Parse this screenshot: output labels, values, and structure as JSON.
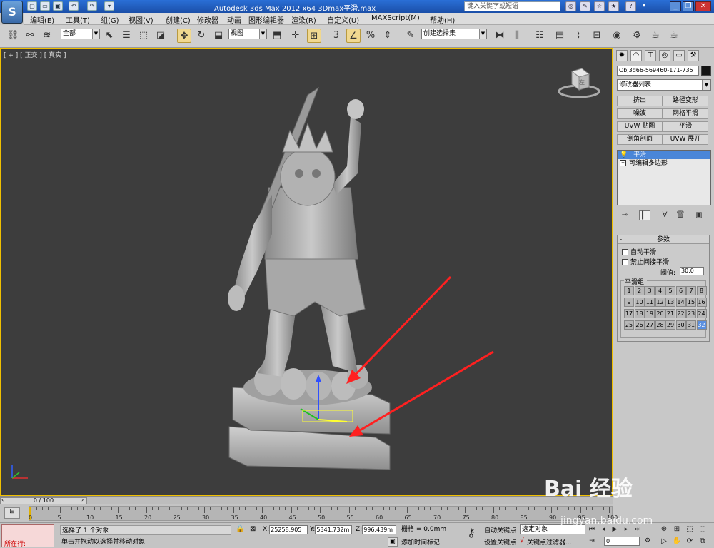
{
  "app": {
    "title": "Autodesk 3ds Max  2012 x64    3Dmax平滑.max",
    "logo_letter": "S",
    "search_placeholder": "键入关键字或短语"
  },
  "quick_access": [
    "new-icon",
    "open-icon",
    "save-icon",
    "undo-icon",
    "redo-icon",
    "dropdown-icon"
  ],
  "title_tools": [
    "binoculars-icon",
    "tools-icon",
    "star-icon",
    "favorite-icon",
    "help-icon"
  ],
  "menus": [
    "编辑(E)",
    "工具(T)",
    "组(G)",
    "视图(V)",
    "创建(C)",
    "修改器",
    "动画",
    "图形编辑器",
    "渲染(R)",
    "自定义(U)",
    "MAXScript(M)",
    "帮助(H)"
  ],
  "toolbar": {
    "selection_filter": "全部",
    "ref_coord": "视图",
    "named_selection": "创建选择集"
  },
  "viewport": {
    "label": "[ + ] [ 正交 ] [ 真实 ]",
    "viewcube_label": "左",
    "border_color": "#f0c000",
    "bg_color": "#3d3d3d"
  },
  "panel": {
    "tabs": [
      "create-icon",
      "modify-icon",
      "hierarchy-icon",
      "motion-icon",
      "display-icon",
      "utilities-icon"
    ],
    "object_name": "Obj3d66-569460-171-735",
    "object_color": "#141414",
    "modifier_list": "修改器列表",
    "modifier_buttons": [
      "挤出",
      "路径变形",
      "噪波",
      "网格平滑",
      "UVW 贴图",
      "平滑",
      "倒角剖面",
      "UVW 展开"
    ],
    "stack": [
      {
        "label": "平滑",
        "selected": true
      },
      {
        "label": "可编辑多边形",
        "selected": false
      }
    ],
    "stack_tools": [
      "pin-stack-icon",
      "show-end-result-icon",
      "make-unique-icon",
      "remove-modifier-icon",
      "configure-sets-icon"
    ],
    "rollout_title": "参数",
    "auto_smooth": "自动平滑",
    "prevent_indirect": "禁止间接平滑",
    "threshold_label": "阈值:",
    "threshold_value": "30.0",
    "smoothing_groups_label": "平滑组:",
    "smoothing_groups": [
      "1",
      "2",
      "3",
      "4",
      "5",
      "6",
      "7",
      "8",
      "9",
      "10",
      "11",
      "12",
      "13",
      "14",
      "15",
      "16",
      "17",
      "18",
      "19",
      "20",
      "21",
      "22",
      "23",
      "24",
      "25",
      "26",
      "27",
      "28",
      "29",
      "30",
      "31",
      "32"
    ],
    "active_group": "32"
  },
  "timeline": {
    "slider": "0 / 100",
    "ticks": [
      "0",
      "5",
      "10",
      "15",
      "20",
      "25",
      "30",
      "35",
      "40",
      "45",
      "50",
      "55",
      "60",
      "65",
      "70",
      "75",
      "80",
      "85",
      "90",
      "95",
      "100"
    ]
  },
  "status": {
    "maxscript_label": "所在行:",
    "selection": "选择了 1 个对象",
    "prompt": "单击并拖动以选择并移动对象",
    "x_label": "X:",
    "x": "25258.905",
    "y_label": "Y:",
    "y": "5341.732m",
    "z_label": "Z:",
    "z": "996.439m",
    "grid": "栅格 = 0.0mm",
    "add_time_tag": "添加时间标记",
    "auto_key": "自动关键点",
    "set_key": "设置关键点",
    "selected_set": "选定对象",
    "key_filters": "关键点过滤器...",
    "frame": "0"
  },
  "watermark": {
    "text": "Bai 经验",
    "url": "jingyan.baidu.com"
  }
}
